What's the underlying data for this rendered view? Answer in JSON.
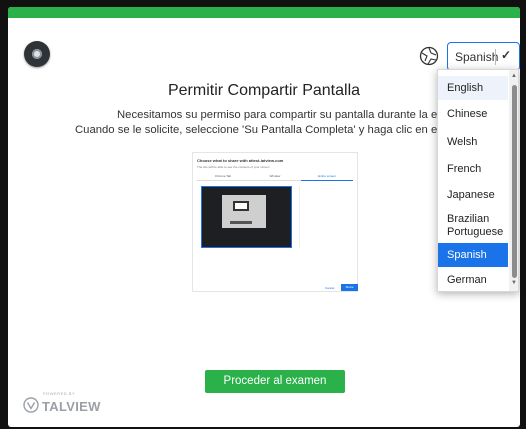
{
  "header": {
    "language_value": "Spanish"
  },
  "main": {
    "title": "Permitir Compartir Pantalla",
    "line1": "Necesitamos su permiso para compartir su pantalla durante la evaluación.",
    "line2": "Cuando se le solicite, seleccione 'Su Pantalla Completa' y haga clic en el botón 'Con",
    "proceed_label": "Proceder al examen"
  },
  "preview": {
    "title": "Choose what to share with attest-latview.com",
    "subtitle": "The site will be able to see the contents of your screen",
    "tabs": [
      "Chrome Tab",
      "Window",
      "Entire screen"
    ],
    "cancel": "Cancel",
    "share": "Share"
  },
  "brand": {
    "powered": "POWERED BY",
    "name": "TALVIEW"
  },
  "language_dropdown": {
    "options": [
      "English",
      "Chinese",
      "Welsh",
      "French",
      "Japanese",
      "Brazilian Portuguese",
      "Spanish",
      "German"
    ],
    "highlighted": "English",
    "selected": "Spanish"
  },
  "colors": {
    "accent_green": "#2ab14a",
    "accent_blue": "#1a73e8"
  }
}
